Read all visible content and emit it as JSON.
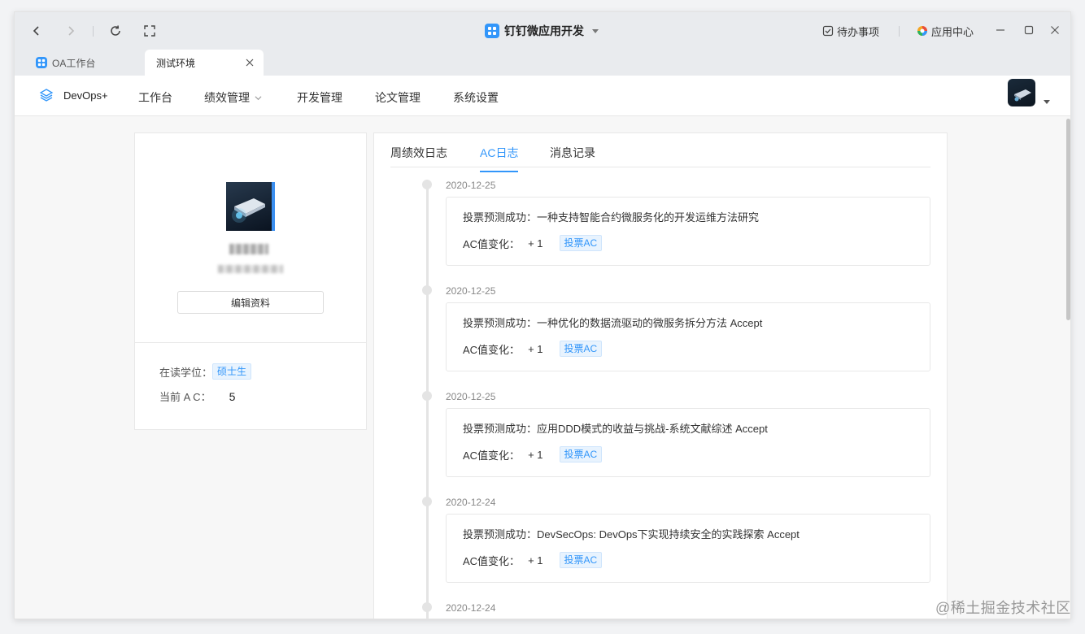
{
  "titlebar": {
    "app_title": "钉钉微应用开发",
    "todo_label": "待办事项",
    "app_center_label": "应用中心"
  },
  "browser_tabs": [
    {
      "label": "OA工作台",
      "active": false
    },
    {
      "label": "测试环境",
      "active": true
    }
  ],
  "header": {
    "brand": "DevOps+",
    "menu": [
      "工作台",
      "绩效管理",
      "开发管理",
      "论文管理",
      "系统设置"
    ]
  },
  "profile": {
    "edit_button": "编辑资料",
    "degree_label": "在读学位：",
    "degree_value": "硕士生",
    "ac_label": "当前 A C：",
    "ac_value": "5"
  },
  "log_tabs": {
    "items": [
      "周绩效日志",
      "AC日志",
      "消息记录"
    ],
    "active": "AC日志"
  },
  "timeline": [
    {
      "date": "2020-12-25",
      "title": "投票预测成功：一种支持智能合约微服务化的开发运维方法研究",
      "ac_label": "AC值变化：",
      "ac_change": "+ 1",
      "tag": "投票AC"
    },
    {
      "date": "2020-12-25",
      "title": "投票预测成功：一种优化的数据流驱动的微服务拆分方法 Accept",
      "ac_label": "AC值变化：",
      "ac_change": "+ 1",
      "tag": "投票AC"
    },
    {
      "date": "2020-12-25",
      "title": "投票预测成功：应用DDD模式的收益与挑战-系统文献综述 Accept",
      "ac_label": "AC值变化：",
      "ac_change": "+ 1",
      "tag": "投票AC"
    },
    {
      "date": "2020-12-24",
      "title": "投票预测成功：DevSecOps: DevOps下实现持续安全的实践探索 Accept",
      "ac_label": "AC值变化：",
      "ac_change": "+ 1",
      "tag": "投票AC"
    },
    {
      "date": "2020-12-24"
    }
  ],
  "watermark": "@稀土掘金技术社区",
  "colors": {
    "accent": "#3296fa",
    "tag_bg": "#e8f3fe"
  }
}
